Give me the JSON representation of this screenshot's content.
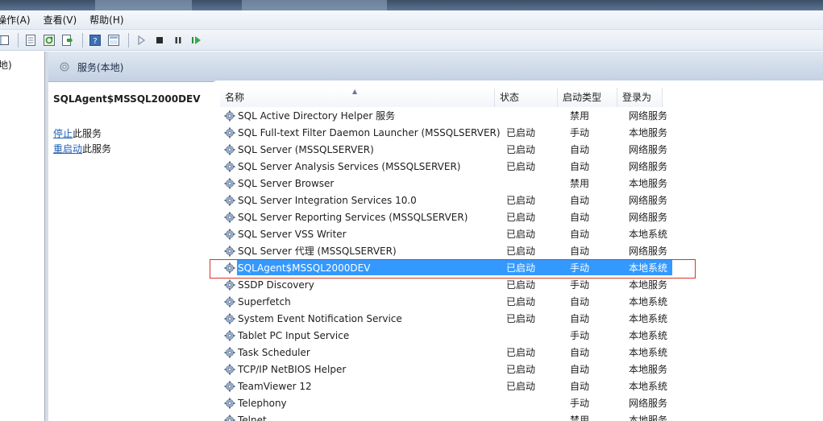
{
  "menu": [
    {
      "label": "操作(A)"
    },
    {
      "label": "查看(V)"
    },
    {
      "label": "帮助(H)"
    }
  ],
  "toolbar": {
    "icons": [
      "back-icon",
      "properties-icon",
      "refresh-icon",
      "export-icon",
      "help-icon",
      "view-icon",
      "start-icon",
      "stop-icon",
      "pause-icon",
      "restart-icon"
    ]
  },
  "tree": {
    "label": "地)"
  },
  "header": {
    "title": "服务(本地)"
  },
  "detail": {
    "service_name": "SQLAgent$MSSQL2000DEV",
    "stop_link": "停止",
    "stop_rest": "此服务",
    "restart_link": "重启动",
    "restart_rest": "此服务"
  },
  "columns": {
    "name": "名称",
    "status": "状态",
    "start_type": "启动类型",
    "logon": "登录为"
  },
  "services": [
    {
      "name": "SQL Active Directory Helper 服务",
      "status": "",
      "start_type": "禁用",
      "logon": "网络服务"
    },
    {
      "name": "SQL Full-text Filter Daemon Launcher (MSSQLSERVER)",
      "status": "已启动",
      "start_type": "手动",
      "logon": "本地服务"
    },
    {
      "name": "SQL Server (MSSQLSERVER)",
      "status": "已启动",
      "start_type": "自动",
      "logon": "网络服务"
    },
    {
      "name": "SQL Server Analysis Services (MSSQLSERVER)",
      "status": "已启动",
      "start_type": "自动",
      "logon": "网络服务"
    },
    {
      "name": "SQL Server Browser",
      "status": "",
      "start_type": "禁用",
      "logon": "本地服务"
    },
    {
      "name": "SQL Server Integration Services 10.0",
      "status": "已启动",
      "start_type": "自动",
      "logon": "网络服务"
    },
    {
      "name": "SQL Server Reporting Services (MSSQLSERVER)",
      "status": "已启动",
      "start_type": "自动",
      "logon": "网络服务"
    },
    {
      "name": "SQL Server VSS Writer",
      "status": "已启动",
      "start_type": "自动",
      "logon": "本地系统"
    },
    {
      "name": "SQL Server 代理 (MSSQLSERVER)",
      "status": "已启动",
      "start_type": "自动",
      "logon": "网络服务"
    },
    {
      "name": "SQLAgent$MSSQL2000DEV",
      "status": "已启动",
      "start_type": "手动",
      "logon": "本地系统",
      "selected": true
    },
    {
      "name": "SSDP Discovery",
      "status": "已启动",
      "start_type": "手动",
      "logon": "本地服务"
    },
    {
      "name": "Superfetch",
      "status": "已启动",
      "start_type": "自动",
      "logon": "本地系统"
    },
    {
      "name": "System Event Notification Service",
      "status": "已启动",
      "start_type": "自动",
      "logon": "本地系统"
    },
    {
      "name": "Tablet PC Input Service",
      "status": "",
      "start_type": "手动",
      "logon": "本地系统"
    },
    {
      "name": "Task Scheduler",
      "status": "已启动",
      "start_type": "自动",
      "logon": "本地系统"
    },
    {
      "name": "TCP/IP NetBIOS Helper",
      "status": "已启动",
      "start_type": "自动",
      "logon": "本地服务"
    },
    {
      "name": "TeamViewer 12",
      "status": "已启动",
      "start_type": "自动",
      "logon": "本地系统"
    },
    {
      "name": "Telephony",
      "status": "",
      "start_type": "手动",
      "logon": "网络服务"
    },
    {
      "name": "Telnet",
      "status": "",
      "start_type": "禁用",
      "logon": "本地服务"
    }
  ],
  "colors": {
    "selection": "#3399ff",
    "highlight_box": "#d9342b",
    "link": "#1f5fb8"
  }
}
